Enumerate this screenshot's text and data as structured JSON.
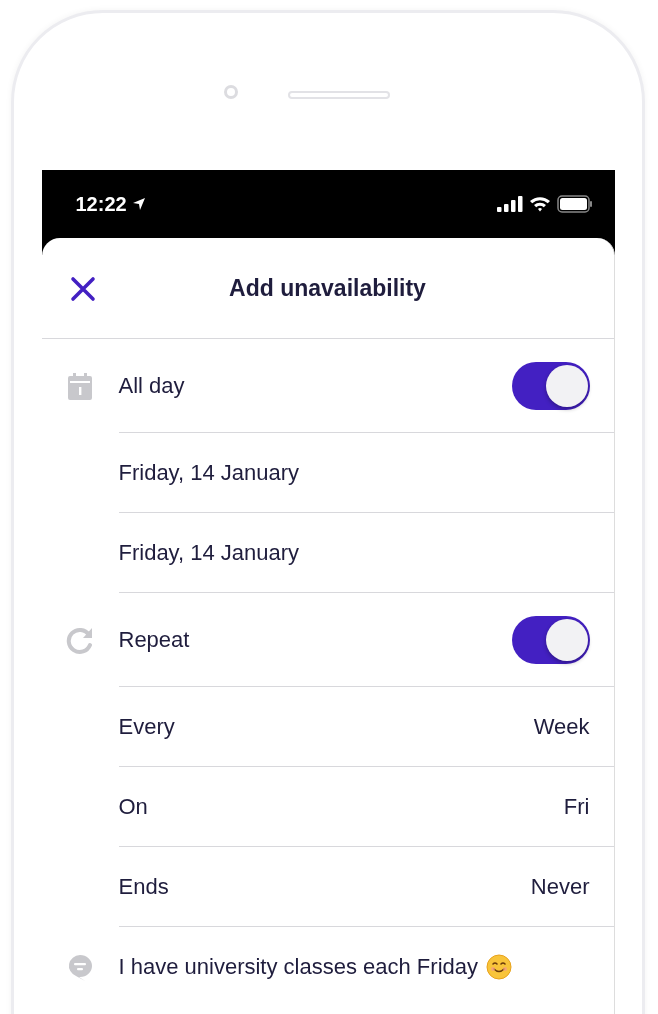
{
  "status_bar": {
    "time": "12:22"
  },
  "header": {
    "title": "Add unavailability"
  },
  "rows": [
    {
      "kind": "allday",
      "label": "All day",
      "on": true
    },
    {
      "kind": "date",
      "label": "Friday, 14 January"
    },
    {
      "kind": "date",
      "label": "Friday, 14 January"
    },
    {
      "kind": "repeat",
      "label": "Repeat",
      "on": true
    },
    {
      "kind": "option",
      "label": "Every",
      "value": "Week"
    },
    {
      "kind": "option",
      "label": "On",
      "value": "Fri"
    },
    {
      "kind": "option",
      "label": "Ends",
      "value": "Never"
    },
    {
      "kind": "note",
      "label": "I have university classes each Friday"
    }
  ]
}
